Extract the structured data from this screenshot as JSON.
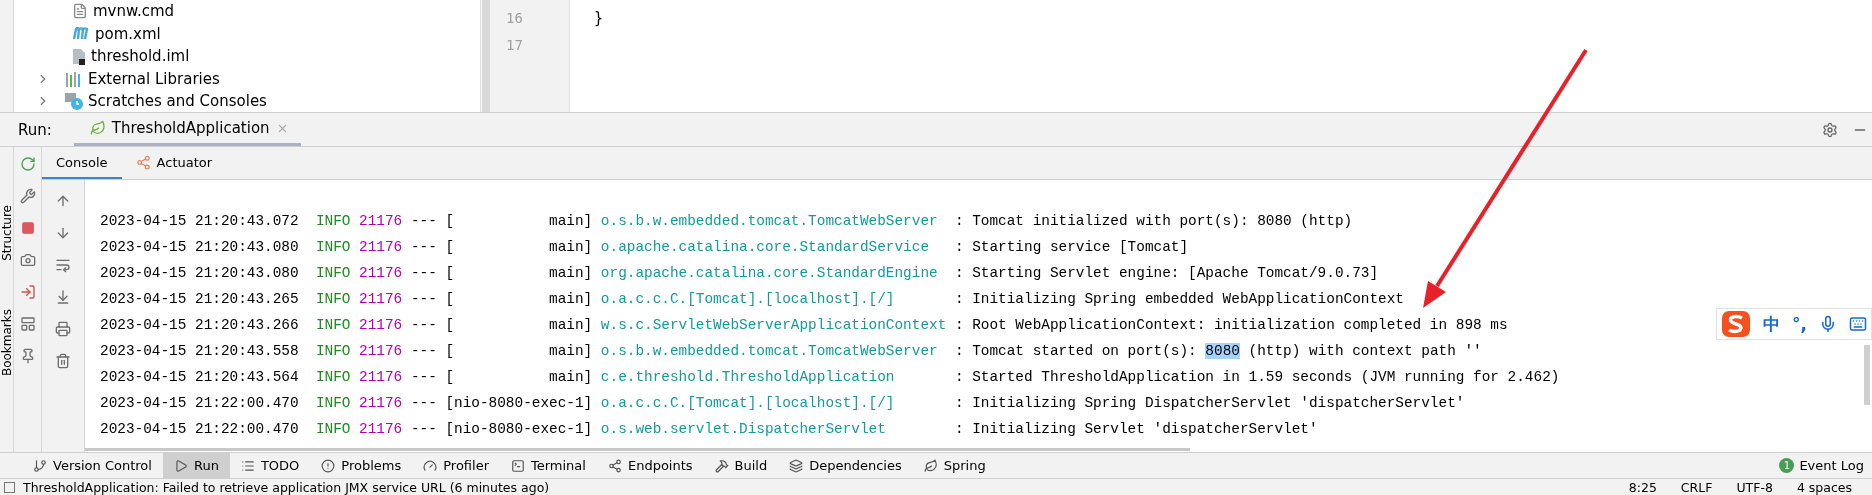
{
  "project_tree": [
    {
      "label": "mvnw.cmd",
      "kind": "text-file",
      "expandable": false,
      "depth_indent": true
    },
    {
      "label": "pom.xml",
      "kind": "maven",
      "expandable": false,
      "depth_indent": true
    },
    {
      "label": "threshold.iml",
      "kind": "module",
      "expandable": false,
      "depth_indent": true
    },
    {
      "label": "External Libraries",
      "kind": "libraries",
      "expandable": true,
      "depth_indent": false
    },
    {
      "label": "Scratches and Consoles",
      "kind": "scratches",
      "expandable": true,
      "depth_indent": false
    }
  ],
  "editor": {
    "lines": [
      {
        "number": "16",
        "code": "}"
      },
      {
        "number": "17"
      }
    ]
  },
  "side_labels": [
    "Structure",
    "Bookmarks"
  ],
  "run_bar": {
    "label": "Run:",
    "tabs": [
      {
        "label": "ThresholdApplication",
        "selected": true
      }
    ]
  },
  "console_tabs": [
    {
      "label": "Console",
      "selected": true,
      "kind": "console"
    },
    {
      "label": "Actuator",
      "selected": false,
      "kind": "actuator"
    }
  ],
  "console_lines": [
    {
      "timestamp": "2023-04-15 21:20:43.072",
      "level": "INFO",
      "pid": "21176",
      "sep": "---",
      "thread": "[           main]",
      "logger": "o.s.b.w.embedded.tomcat.TomcatWebServer",
      "message": ": Tomcat initialized with port(s): 8080 (http)"
    },
    {
      "timestamp": "2023-04-15 21:20:43.080",
      "level": "INFO",
      "pid": "21176",
      "sep": "---",
      "thread": "[           main]",
      "logger": "o.apache.catalina.core.StandardService",
      "message": ": Starting service [Tomcat]"
    },
    {
      "timestamp": "2023-04-15 21:20:43.080",
      "level": "INFO",
      "pid": "21176",
      "sep": "---",
      "thread": "[           main]",
      "logger": "org.apache.catalina.core.StandardEngine",
      "message": ": Starting Servlet engine: [Apache Tomcat/9.0.73]"
    },
    {
      "timestamp": "2023-04-15 21:20:43.265",
      "level": "INFO",
      "pid": "21176",
      "sep": "---",
      "thread": "[           main]",
      "logger": "o.a.c.c.C.[Tomcat].[localhost].[/]",
      "message": ": Initializing Spring embedded WebApplicationContext"
    },
    {
      "timestamp": "2023-04-15 21:20:43.266",
      "level": "INFO",
      "pid": "21176",
      "sep": "---",
      "thread": "[           main]",
      "logger": "w.s.c.ServletWebServerApplicationContext",
      "message": ": Root WebApplicationContext: initialization completed in 898 ms"
    },
    {
      "timestamp": "2023-04-15 21:20:43.558",
      "level": "INFO",
      "pid": "21176",
      "sep": "---",
      "thread": "[           main]",
      "logger": "o.s.b.w.embedded.tomcat.TomcatWebServer",
      "message": [
        {
          "text": ": Tomcat started on port(s): ",
          "selected": false
        },
        {
          "text": "8080",
          "selected": true
        },
        {
          "text": " (http) with context path ''",
          "selected": false
        }
      ]
    },
    {
      "timestamp": "2023-04-15 21:20:43.564",
      "level": "INFO",
      "pid": "21176",
      "sep": "---",
      "thread": "[           main]",
      "logger": "c.e.threshold.ThresholdApplication",
      "message": ": Started ThresholdApplication in 1.59 seconds (JVM running for 2.462)"
    },
    {
      "timestamp": "2023-04-15 21:22:00.470",
      "level": "INFO",
      "pid": "21176",
      "sep": "---",
      "thread": "[nio-8080-exec-1]",
      "logger": "o.a.c.c.C.[Tomcat].[localhost].[/]",
      "message": ": Initializing Spring DispatcherServlet 'dispatcherServlet'"
    },
    {
      "timestamp": "2023-04-15 21:22:00.470",
      "level": "INFO",
      "pid": "21176",
      "sep": "---",
      "thread": "[nio-8080-exec-1]",
      "logger": "o.s.web.servlet.DispatcherServlet",
      "message": ": Initializing Servlet 'dispatcherServlet'"
    }
  ],
  "ime_toolbar": {
    "items": [
      {
        "kind": "logo"
      },
      {
        "kind": "text",
        "label": "中"
      },
      {
        "kind": "text",
        "label": "°,"
      },
      {
        "kind": "mic"
      },
      {
        "kind": "keyboard"
      }
    ]
  },
  "tool_windows": [
    {
      "label": "Version Control",
      "kind": "vcs",
      "selected": false
    },
    {
      "label": "Run",
      "kind": "run",
      "selected": true
    },
    {
      "label": "TODO",
      "kind": "todo",
      "selected": false
    },
    {
      "label": "Problems",
      "kind": "problems",
      "selected": false
    },
    {
      "label": "Profiler",
      "kind": "profiler",
      "selected": false
    },
    {
      "label": "Terminal",
      "kind": "terminal",
      "selected": false
    },
    {
      "label": "Endpoints",
      "kind": "endpoints",
      "selected": false
    },
    {
      "label": "Build",
      "kind": "build",
      "selected": false
    },
    {
      "label": "Dependencies",
      "kind": "dependencies",
      "selected": false
    },
    {
      "label": "Spring",
      "kind": "spring",
      "selected": false
    }
  ],
  "event_log": {
    "count": "1",
    "label": "Event Log"
  },
  "status_bar": {
    "message": "ThresholdApplication: Failed to retrieve application JMX service URL (6 minutes ago)",
    "items": [
      "8:25",
      "CRLF",
      "UTF-8",
      "4 spaces"
    ]
  }
}
